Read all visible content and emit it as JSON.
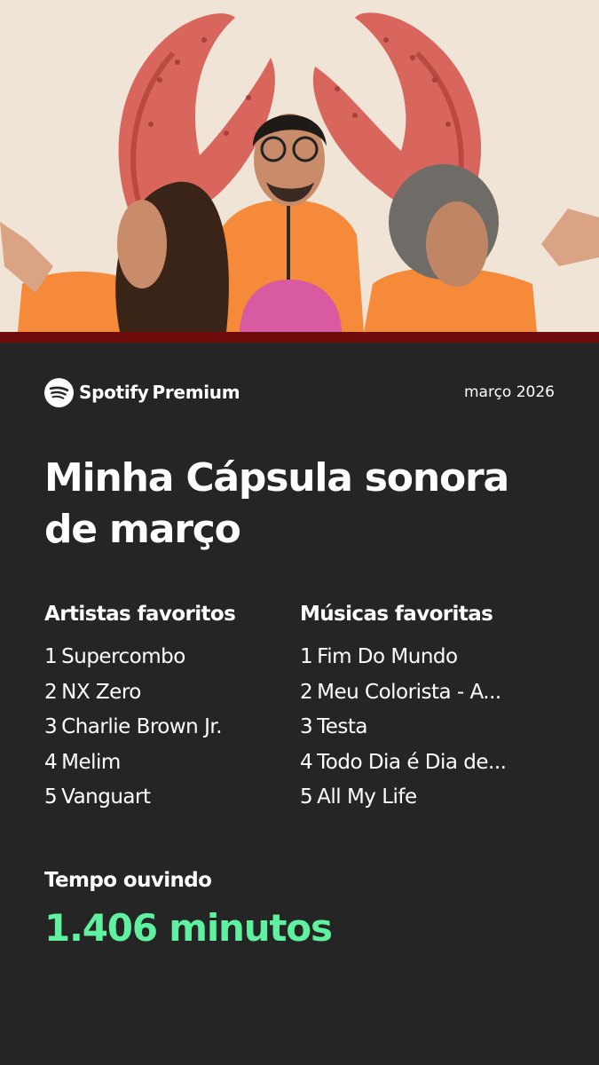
{
  "brand": {
    "name": "Spotify",
    "tier": "Premium",
    "logo_icon": "spotify-logo-icon"
  },
  "date_label": "março 2026",
  "title_line1": "Minha Cápsula sonora",
  "title_line2": "de março",
  "top_artists": {
    "heading": "Artistas favoritos",
    "items": [
      {
        "rank": "1",
        "name": "Supercombo"
      },
      {
        "rank": "2",
        "name": "NX Zero"
      },
      {
        "rank": "3",
        "name": "Charlie Brown Jr."
      },
      {
        "rank": "4",
        "name": "Melim"
      },
      {
        "rank": "5",
        "name": "Vanguart"
      }
    ]
  },
  "top_tracks": {
    "heading": "Músicas favoritas",
    "items": [
      {
        "rank": "1",
        "name": "Fim Do Mundo"
      },
      {
        "rank": "2",
        "name": "Meu Colorista - A..."
      },
      {
        "rank": "3",
        "name": "Testa"
      },
      {
        "rank": "4",
        "name": "Todo Dia é Dia de..."
      },
      {
        "rank": "5",
        "name": "All My Life"
      }
    ]
  },
  "listening_time": {
    "label": "Tempo ouvindo",
    "value": "1.406 minutos"
  },
  "colors": {
    "background": "#252525",
    "accent_green": "#5ff0a0",
    "hero_background": "#efe4d6",
    "hero_strip": "#6e0c0c"
  }
}
